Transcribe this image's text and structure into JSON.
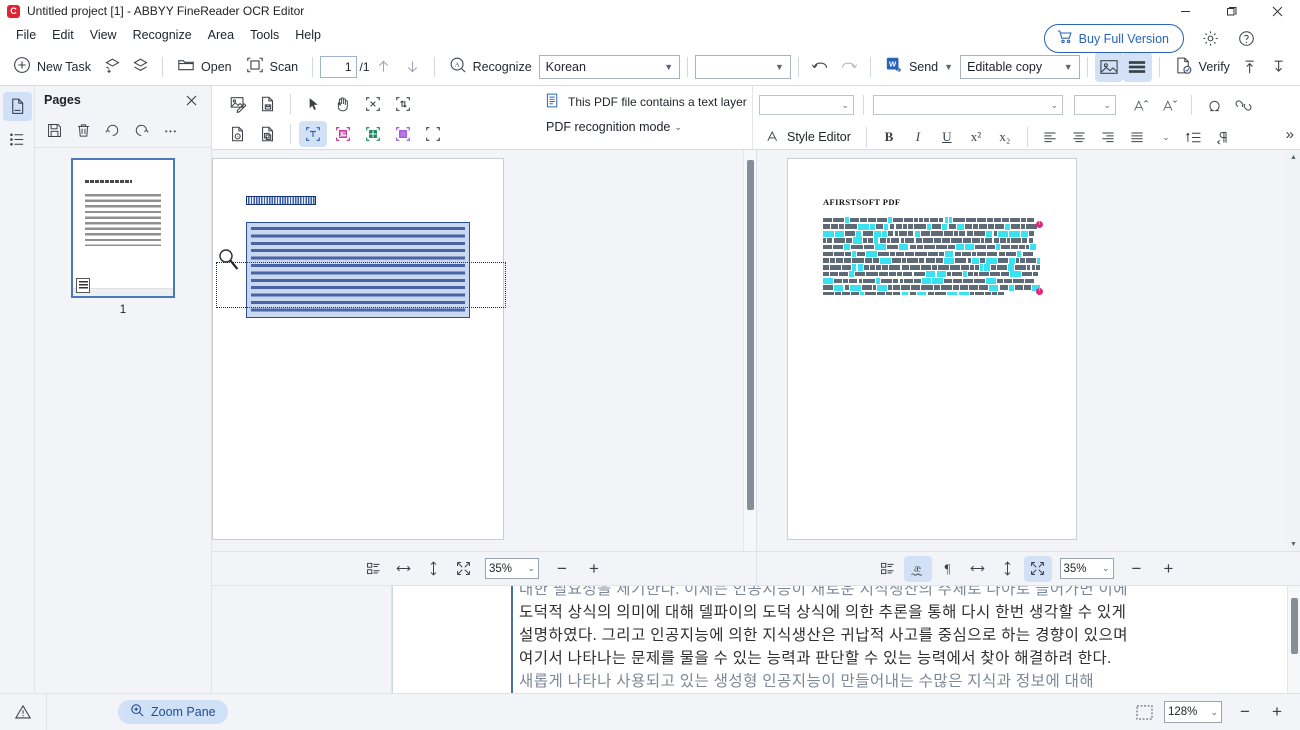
{
  "window": {
    "title": "Untitled project [1] - ABBYY FineReader OCR Editor",
    "logo_letter": "C",
    "minimize": "minimize-icon",
    "restore": "restore-icon",
    "close": "close-icon"
  },
  "menubar": {
    "items": [
      "File",
      "Edit",
      "View",
      "Recognize",
      "Area",
      "Tools",
      "Help"
    ],
    "buy_label": "Buy Full Version",
    "buy_icon": "shopping-cart-icon",
    "gear_icon": "gear-icon",
    "help_icon": "help-circle-icon",
    "accent": "#2a63b8"
  },
  "toolbar": {
    "new_task": "New Task",
    "new_task_icon": "plus-circle-icon",
    "add_pages_icon": "add-layers-icon",
    "layers_icon": "layers-icon",
    "open": "Open",
    "open_icon": "folder-open-icon",
    "scan": "Scan",
    "scan_icon": "scanner-frame-icon",
    "page_current": "1",
    "page_total": "/1",
    "prev_page_icon": "arrow-up-icon",
    "next_page_icon": "arrow-down-icon",
    "recognize": "Recognize",
    "recognize_icon": "recognize-a-icon",
    "language": "Korean",
    "language_empty": "",
    "undo_icon": "undo-icon",
    "redo_icon": "redo-icon",
    "send": "Send",
    "send_icon": "word-export-icon",
    "output_mode": "Editable copy",
    "view_image_icon": "image-view-icon",
    "view_text_icon": "text-view-icon",
    "verify": "Verify",
    "verify_icon": "verify-doc-icon",
    "export_up_icon": "export-up-icon",
    "export_down_icon": "export-down-icon"
  },
  "rail": {
    "pages_icon": "page-icon",
    "list_icon": "list-icon"
  },
  "pages_panel": {
    "title": "Pages",
    "close_icon": "close-icon",
    "tools": [
      {
        "name": "save-icon"
      },
      {
        "name": "delete-trash-icon"
      },
      {
        "name": "rotate-left-icon"
      },
      {
        "name": "rotate-right-icon"
      },
      {
        "name": "more-ellipsis-icon"
      }
    ],
    "thumbnail_page_number": "1"
  },
  "work_toolbar": {
    "row1": [
      {
        "name": "edit-image-icon"
      },
      {
        "name": "save-page-icon"
      }
    ],
    "row2": [
      {
        "name": "inspect-page-icon"
      },
      {
        "name": "copy-page-icon"
      }
    ],
    "tools_row1": [
      {
        "name": "pointer-tool",
        "selected": false
      },
      {
        "name": "hand-pan-tool",
        "selected": false
      },
      {
        "name": "delete-area-tool",
        "selected": false
      },
      {
        "name": "reorder-area-tool",
        "selected": false
      }
    ],
    "tools_row2": [
      {
        "name": "text-area-tool",
        "selected": true,
        "color": "#2a63b8"
      },
      {
        "name": "picture-area-tool",
        "selected": false,
        "color": "#c2298f"
      },
      {
        "name": "table-area-tool",
        "selected": false,
        "color": "#128a5a"
      },
      {
        "name": "background-picture-area-tool",
        "selected": false,
        "color": "#9b4fd6"
      },
      {
        "name": "recognition-area-tool",
        "selected": false,
        "color": "#3a4047"
      }
    ],
    "pdf_note": "This PDF file contains a text layer",
    "pdf_note_icon": "document-text-layer-icon",
    "pdf_mode": "PDF recognition mode",
    "pdf_mode_chevron": "chevron-down-icon",
    "style_editor": "Style Editor",
    "style_editor_icon": "style-a-icon",
    "font_name": "",
    "font_style": "",
    "font_size": "",
    "grow_font_icon": "increase-font-icon",
    "shrink_font_icon": "decrease-font-icon",
    "symbol_icon": "omega-symbol-icon",
    "link_icon": "link-icon",
    "bold": "B",
    "italic": "I",
    "underline": "U",
    "superscript": "x²",
    "subscript": "x₂",
    "align_left_icon": "align-left-icon",
    "align_center_icon": "align-center-icon",
    "align_right_icon": "align-right-icon",
    "align_justify_icon": "align-justify-icon",
    "line_spacing_icon": "line-spacing-icon",
    "indent_icon": "indent-icon",
    "rtl_icon": "text-direction-icon",
    "more_chevron": "chevron-double-right-icon"
  },
  "image_pane": {
    "document_title_text": "AFIRSTSOFT PDF",
    "selected_block": "text-block",
    "marquee": "selection-marquee",
    "cursor": "magnifier-cursor",
    "bottom": {
      "layout_icon": "block-order-icon",
      "fit_width_icon": "fit-width-icon",
      "fit_height_icon": "fit-height-icon",
      "fit_page_icon": "fit-page-icon",
      "zoom_value": "35%",
      "minus": "−",
      "plus": "+"
    }
  },
  "text_pane": {
    "document_title_text": "AFIRSTSOFT PDF",
    "bottom": {
      "layout_icon": "block-order-icon",
      "low_confidence_icon": "low-confidence-ae-icon",
      "nonprinting_icon": "pilcrow-icon",
      "fit_width_icon": "fit-width-icon",
      "fit_height_icon": "fit-height-icon",
      "fit_page_icon": "fit-page-icon",
      "zoom_value": "35%",
      "minus": "−",
      "plus": "+",
      "low_confidence_on": true,
      "fit_page_on": true
    }
  },
  "zoom_pane": {
    "lines": [
      "대한 필요성을 제기한다. 이제는 인공지능이 새로운 지식생산의 주체로 나아로 들어가면 이에",
      "도덕적 상식의 의미에 대해 델파이의 도덕 상식에 의한 추론을 통해 다시 한번 생각할 수 있게",
      "설명하였다. 그리고 인공지능에 의한 지식생산은 귀납적 사고를 중심으로 하는 경향이 있으며",
      "여기서 나타나는 문제를 물을 수 있는 능력과 판단할 수 있는 능력에서 찾아 해결하려 한다.",
      "새롭게 나타나 사용되고 있는 생성형 인공지능이 만들어내는 수많은 지식과 정보에 대해"
    ]
  },
  "statusbar": {
    "warning_icon": "warning-triangle-icon",
    "zoom_pane_label": "Zoom Pane",
    "zoom_pane_icon": "magnifier-plus-icon",
    "select_region_icon": "dashed-selection-icon",
    "zoom_value": "128%",
    "minus": "−",
    "plus": "+"
  }
}
